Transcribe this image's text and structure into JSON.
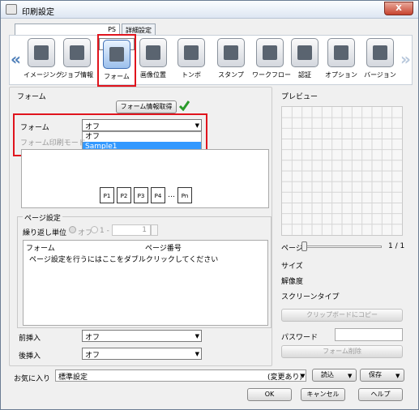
{
  "window": {
    "title": "印刷設定",
    "close_label": "X"
  },
  "tabs": [
    {
      "label": "PS"
    },
    {
      "label": "詳細設定"
    }
  ],
  "toolbar": {
    "left_arrow": "«",
    "right_arrow": "»",
    "items": [
      {
        "label": "イメージング",
        "icon": "imaging-icon"
      },
      {
        "label": "ジョブ情報",
        "icon": "job-info-icon"
      },
      {
        "label": "フォーム",
        "icon": "form-icon",
        "selected": true
      },
      {
        "label": "画像位置",
        "icon": "image-position-icon"
      },
      {
        "label": "トンボ",
        "icon": "crop-mark-icon"
      },
      {
        "label": "スタンプ",
        "icon": "stamp-icon"
      },
      {
        "label": "ワークフロー",
        "icon": "workflow-icon"
      },
      {
        "label": "認証",
        "icon": "authentication-icon"
      },
      {
        "label": "オプション",
        "icon": "option-icon"
      },
      {
        "label": "バージョン",
        "icon": "version-icon"
      }
    ]
  },
  "form_group": {
    "title": "フォーム",
    "get_info_button": "フォーム情報取得",
    "check_icon": "check-icon",
    "form_label": "フォーム",
    "form_value": "オフ",
    "form_options": [
      "オフ",
      "Sample1"
    ],
    "print_mode_label": "フォーム印刷モード",
    "pages": [
      "P1",
      "P2",
      "P3",
      "P4",
      "…",
      "Pn"
    ]
  },
  "page_settings": {
    "title": "ページ設定",
    "repeat_label": "繰り返し単位",
    "repeat_off": "オフ",
    "repeat_one": "1 -",
    "repeat_value": "1",
    "col_form": "フォーム",
    "col_page": "ページ番号",
    "hint": "ページ設定を行うにはここをダブルクリックしてください"
  },
  "front_insert": {
    "label": "前挿入",
    "value": "オフ"
  },
  "back_insert": {
    "label": "後挿入",
    "value": "オフ"
  },
  "preview": {
    "title": "プレビュー",
    "page_label": "ページ",
    "page_count": "1 / 1",
    "size_label": "サイズ",
    "resolution_label": "解像度",
    "screen_label": "スクリーンタイプ",
    "copy_button": "クリップボードにコピー",
    "password_label": "パスワード",
    "delete_button": "フォーム削除"
  },
  "favorites": {
    "label": "お気に入り",
    "value": "標準設定",
    "status": "(変更あり)",
    "load": "読込",
    "save": "保存"
  },
  "footer": {
    "ok": "OK",
    "cancel": "キャンセル",
    "help": "ヘルプ"
  },
  "colors": {
    "highlight": "#e0141d",
    "selection": "#3399ff",
    "accent": "#4c7db8"
  }
}
